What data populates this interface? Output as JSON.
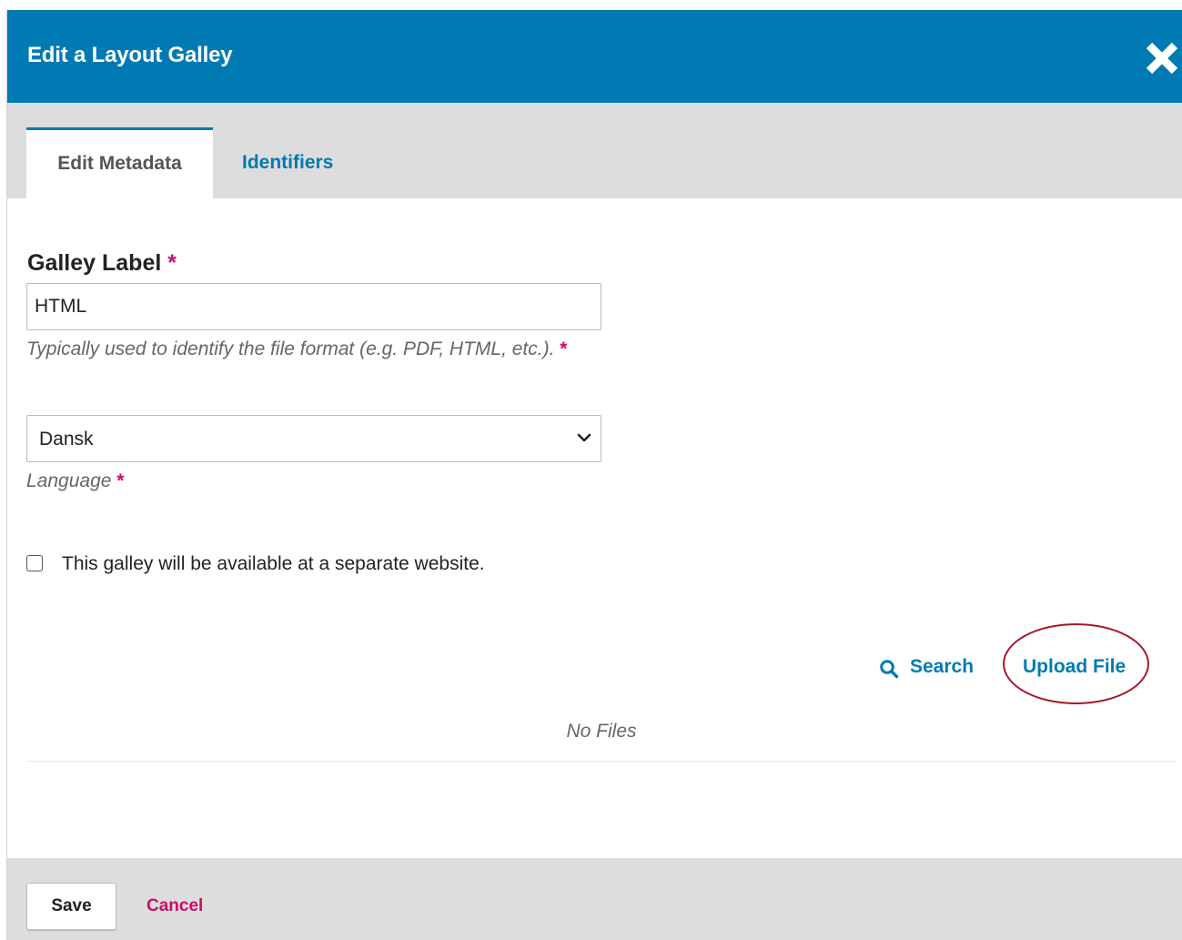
{
  "modal": {
    "title": "Edit a Layout Galley",
    "close_icon": "close-icon"
  },
  "tabs": [
    {
      "label": "Edit Metadata",
      "active": true
    },
    {
      "label": "Identifiers",
      "active": false
    }
  ],
  "form": {
    "galley_label": {
      "label": "Galley Label",
      "required_mark": "*",
      "value": "HTML",
      "description": "Typically used to identify the file format (e.g. PDF, HTML, etc.).",
      "description_required_mark": "*"
    },
    "language": {
      "selected": "Dansk",
      "description": "Language",
      "required_mark": "*"
    },
    "remote": {
      "checked": false,
      "label": "This galley will be available at a separate website."
    }
  },
  "files": {
    "search_label": "Search",
    "search_icon": "search-icon",
    "upload_label": "Upload File",
    "empty_text": "No Files"
  },
  "footer": {
    "save_label": "Save",
    "cancel_label": "Cancel"
  },
  "colors": {
    "header": "#007ab2",
    "link": "#007ab2",
    "required": "#d00a6c",
    "highlight_ring": "#a8152a",
    "bars": "#dddddd"
  }
}
